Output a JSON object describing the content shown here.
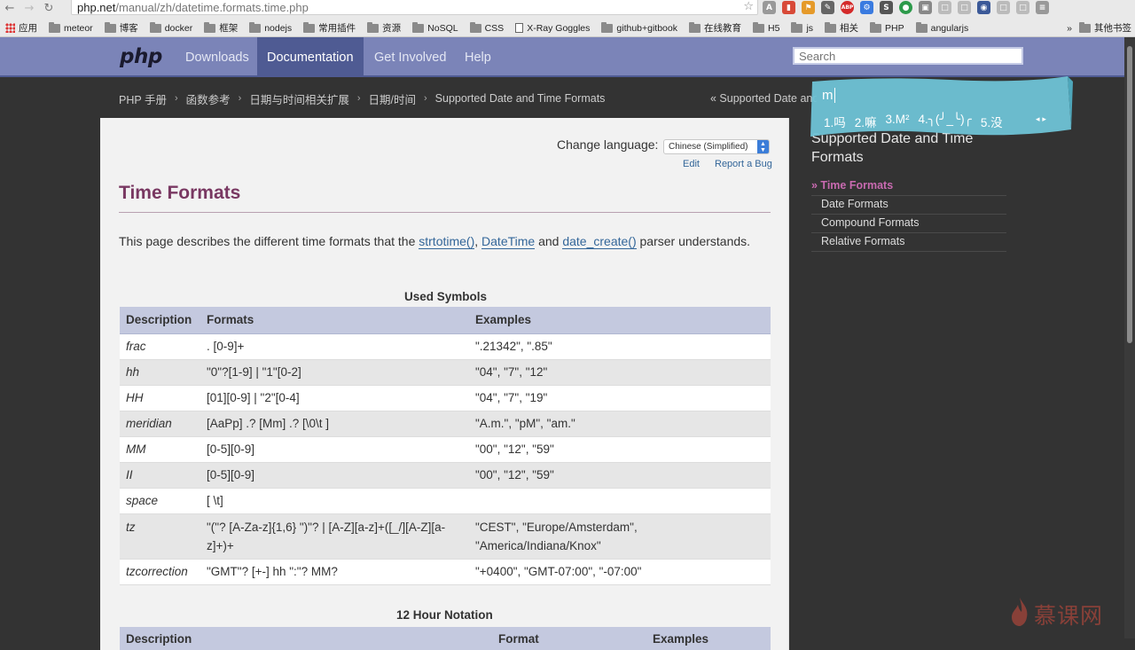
{
  "browser": {
    "url_host": "php.net",
    "url_path": "/manual/zh/datetime.formats.time.php",
    "bookmarks": [
      "应用",
      "meteor",
      "博客",
      "docker",
      "框架",
      "nodejs",
      "常用插件",
      "资源",
      "NoSQL",
      "CSS",
      "X-Ray Goggles",
      "github+gitbook",
      "在线教育",
      "H5",
      "js",
      "相关",
      "PHP",
      "angularjs"
    ],
    "bookmarks_more": "其他书签",
    "ext_badge": "ABP"
  },
  "php_nav": {
    "logo": "php",
    "links": [
      "Downloads",
      "Documentation",
      "Get Involved",
      "Help"
    ],
    "active": "Documentation",
    "search_placeholder": "Search"
  },
  "breadcrumbs": [
    "PHP 手册",
    "函数参考",
    "日期与时间相关扩展",
    "日期/时间",
    "Supported Date and Time Formats"
  ],
  "prev_link": "« Supported Date and Time Formats",
  "content": {
    "change_language_label": "Change language:",
    "language_value": "Chinese (Simplified)",
    "edit": "Edit",
    "report_bug": "Report a Bug",
    "title": "Time Formats",
    "intro_pre": "This page describes the different time formats that the ",
    "intro_link1": "strtotime()",
    "intro_sep1": ", ",
    "intro_link2": "DateTime",
    "intro_mid": " and ",
    "intro_link3": "date_create()",
    "intro_post": " parser understands."
  },
  "symbols_table": {
    "caption": "Used Symbols",
    "headers": [
      "Description",
      "Formats",
      "Examples"
    ],
    "rows": [
      {
        "desc": "frac",
        "format": ". [0-9]+",
        "example": "\".21342\", \".85\""
      },
      {
        "desc": "hh",
        "format": "\"0\"?[1-9] | \"1\"[0-2]",
        "example": "\"04\", \"7\", \"12\""
      },
      {
        "desc": "HH",
        "format": "[01][0-9] | \"2\"[0-4]",
        "example": "\"04\", \"7\", \"19\""
      },
      {
        "desc": "meridian",
        "format": "[AaPp] .? [Mm] .? [\\0\\t ]",
        "example": "\"A.m.\", \"pM\", \"am.\""
      },
      {
        "desc": "MM",
        "format": "[0-5][0-9]",
        "example": "\"00\", \"12\", \"59\""
      },
      {
        "desc": "II",
        "format": "[0-5][0-9]",
        "example": "\"00\", \"12\", \"59\""
      },
      {
        "desc": "space",
        "format": "[ \\t]",
        "example": ""
      },
      {
        "desc": "tz",
        "format": "\"(\"? [A-Za-z]{1,6} \")\"? | [A-Z][a-z]+([_/][A-Z][a-z]+)+",
        "example": "\"CEST\", \"Europe/Amsterdam\", \"America/Indiana/Knox\""
      },
      {
        "desc": "tzcorrection",
        "format": "\"GMT\"? [+-] hh \":\"? MM?",
        "example": "\"+0400\", \"GMT-07:00\", \"-07:00\""
      }
    ]
  },
  "notation_table": {
    "caption": "12 Hour Notation",
    "headers": [
      "Description",
      "Format",
      "Examples"
    ]
  },
  "sidebar": {
    "title": "Supported Date and Time Formats",
    "items": [
      "» Time Formats",
      "Date Formats",
      "Compound Formats",
      "Relative Formats"
    ]
  },
  "ime": {
    "input": "m",
    "candidates": [
      "1.吗",
      "2.嘛",
      "3.M²",
      "4.╮(╯_╰)╭",
      "5.没"
    ],
    "nav": "◂ ▸"
  },
  "watermark": "慕课网",
  "colors": {
    "nav_bg": "#7b84b8",
    "nav_active": "#4f5b93",
    "title": "#793862",
    "link": "#336699",
    "sidebar_current": "#c86ab0",
    "ime": "#6fc3d6"
  }
}
